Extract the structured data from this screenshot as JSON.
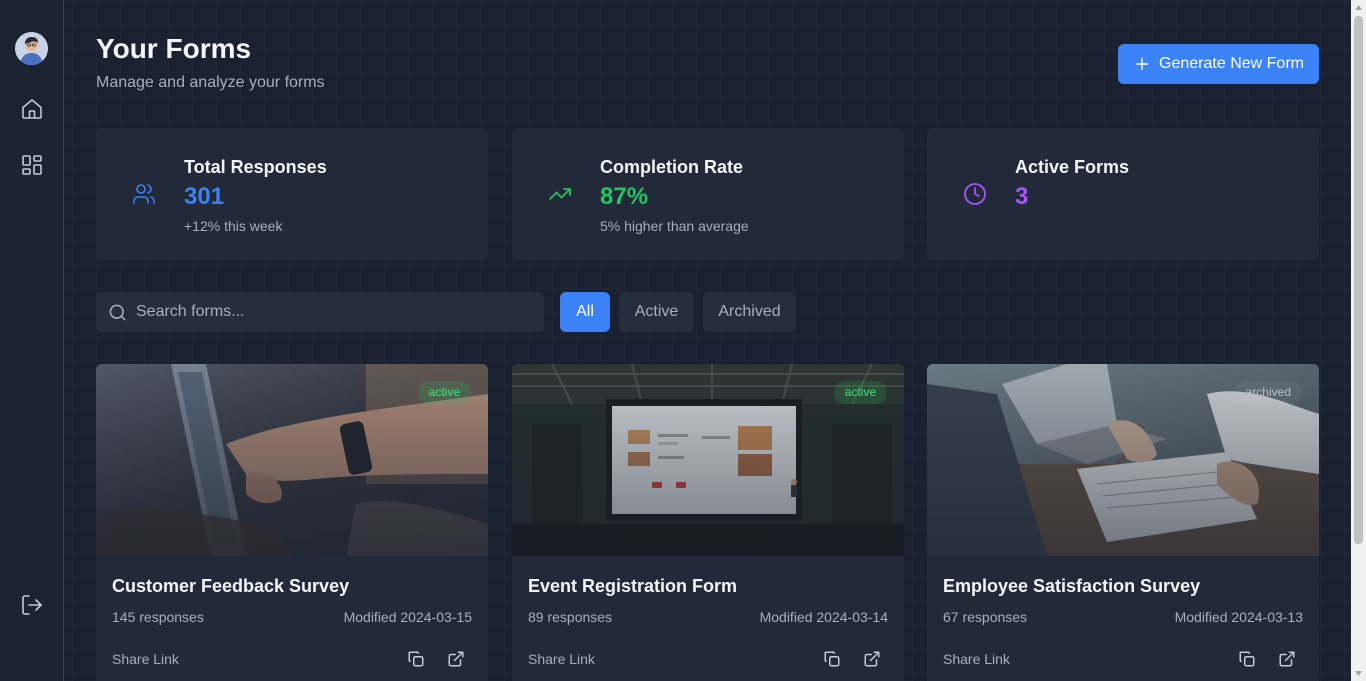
{
  "header": {
    "title": "Your Forms",
    "subtitle": "Manage and analyze your forms",
    "generate_button_label": "Generate New Form"
  },
  "sidebar": {
    "items": [
      {
        "name": "home",
        "icon": "home-icon"
      },
      {
        "name": "dashboard",
        "icon": "grid-icon"
      },
      {
        "name": "logout",
        "icon": "log-out-icon"
      }
    ]
  },
  "stats": [
    {
      "title": "Total Responses",
      "value": "301",
      "note": "+12% this week",
      "icon": "users-icon",
      "color": "#3b82f6"
    },
    {
      "title": "Completion Rate",
      "value": "87%",
      "note": "5% higher than average",
      "icon": "trending-up-icon",
      "color": "#22c55e"
    },
    {
      "title": "Active Forms",
      "value": "3",
      "note": "",
      "icon": "clock-icon",
      "color": "#a855f7"
    }
  ],
  "search": {
    "placeholder": "Search forms...",
    "value": ""
  },
  "filters": [
    {
      "label": "All",
      "selected": true
    },
    {
      "label": "Active",
      "selected": false
    },
    {
      "label": "Archived",
      "selected": false
    }
  ],
  "forms": [
    {
      "title": "Customer Feedback Survey",
      "responses": "145 responses",
      "modified": "Modified 2024-03-15",
      "status": "active",
      "share_label": "Share Link"
    },
    {
      "title": "Event Registration Form",
      "responses": "89 responses",
      "modified": "Modified 2024-03-14",
      "status": "active",
      "share_label": "Share Link"
    },
    {
      "title": "Employee Satisfaction Survey",
      "responses": "67 responses",
      "modified": "Modified 2024-03-13",
      "status": "archived",
      "share_label": "Share Link"
    }
  ],
  "colors": {
    "background": "#1a2130",
    "card": "#222a39",
    "accent": "#3b82f6",
    "success": "#22c55e",
    "purple": "#a855f7"
  }
}
